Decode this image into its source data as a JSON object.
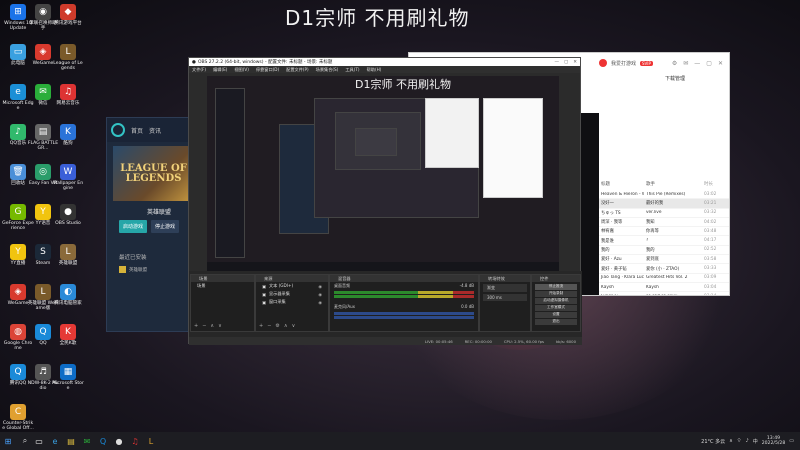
{
  "wallpaper": {
    "title": "D1宗师 不用刷礼物"
  },
  "desktop_icons": [
    {
      "label": "Windows 10 Update",
      "color": "#1a73e8",
      "glyph": "⊞"
    },
    {
      "label": "掌联召唤师助手",
      "color": "#444",
      "glyph": "◉"
    },
    {
      "label": "腾讯游戏平台",
      "color": "#cf3b2b",
      "glyph": "◆"
    },
    {
      "label": "此电脑",
      "color": "#3aa0e0",
      "glyph": "▭"
    },
    {
      "label": "WeGame",
      "color": "#d83a2e",
      "glyph": "◈"
    },
    {
      "label": "League of Legends",
      "color": "#7a5a2a",
      "glyph": "L"
    },
    {
      "label": "Microsoft Edge",
      "color": "#1b8fd6",
      "glyph": "e"
    },
    {
      "label": "微信",
      "color": "#2aae3a",
      "glyph": "✉"
    },
    {
      "label": "网易云音乐",
      "color": "#d33",
      "glyph": "♫"
    },
    {
      "label": "QQ音乐",
      "color": "#31b96c",
      "glyph": "♪"
    },
    {
      "label": "FLAG BATTLEGR...",
      "color": "#666",
      "glyph": "▤"
    },
    {
      "label": "酷狗",
      "color": "#2a73d8",
      "glyph": "K"
    },
    {
      "label": "回收站",
      "color": "#4a8fd8",
      "glyph": "🗑"
    },
    {
      "label": "Easy Fan VR",
      "color": "#2a9d6a",
      "glyph": "◎"
    },
    {
      "label": "Wallpaper Engine",
      "color": "#3a5fd8",
      "glyph": "W"
    },
    {
      "label": "GeForce Experience",
      "color": "#76b900",
      "glyph": "G"
    },
    {
      "label": "YY语音",
      "color": "#f1c40f",
      "glyph": "Y"
    },
    {
      "label": "OBS Studio",
      "color": "#333",
      "glyph": "●"
    },
    {
      "label": "YY直播",
      "color": "#f1c40f",
      "glyph": "Y"
    },
    {
      "label": "Steam",
      "color": "#1b2838",
      "glyph": "S"
    },
    {
      "label": "英雄联盟",
      "color": "#8a6a3a",
      "glyph": "L"
    },
    {
      "label": "WeGame",
      "color": "#d83a2e",
      "glyph": "◈"
    },
    {
      "label": "英雄联盟 WeGame版",
      "color": "#7a5a2a",
      "glyph": "L"
    },
    {
      "label": "腾讯电脑管家",
      "color": "#2a8ad8",
      "glyph": "◐"
    },
    {
      "label": "Google Chrome",
      "color": "#db4437",
      "glyph": "◍"
    },
    {
      "label": "QQ",
      "color": "#1a8ad8",
      "glyph": "Q"
    },
    {
      "label": "全民K歌",
      "color": "#e53935",
      "glyph": "K"
    },
    {
      "label": "腾讯QQ",
      "color": "#1a8ad8",
      "glyph": "Q"
    },
    {
      "label": "NDW-8K-2 Audio",
      "color": "#555",
      "glyph": "♬"
    },
    {
      "label": "Microsoft Store",
      "color": "#0d6cc6",
      "glyph": "▦"
    },
    {
      "label": "Counter-Strike Global Off...",
      "color": "#e0a030",
      "glyph": "C"
    }
  ],
  "launcher": {
    "tab1": "首页",
    "tab2": "资讯",
    "cover_text": "LEAGUE OF LEGENDS",
    "game_name": "英雄联盟",
    "start_label": "启动游戏",
    "alt_label": "停止游戏",
    "recent_label": "最近已安装",
    "recent_game": "英雄联盟"
  },
  "music": {
    "user": "我爱打游戏",
    "vip": "SVIP",
    "download": "下载管理",
    "cols": [
      "标题",
      "歌手",
      "时长"
    ],
    "tracks": [
      {
        "title": "Heaven & Hieron - Wo...",
        "artist": "This Pie (Remixes)",
        "time": "03:02"
      },
      {
        "title": "没好一",
        "artist": "最好的我",
        "time": "03:21"
      },
      {
        "title": "ちゅっ TS",
        "artist": "ver.live",
        "time": "03:32"
      },
      {
        "title": "周深 · 我等",
        "artist": "我知",
        "time": "04:02"
      },
      {
        "title": "林宥嘉",
        "artist": "你再等",
        "time": "03:48"
      },
      {
        "title": "我是谁",
        "artist": "?",
        "time": "04:17"
      },
      {
        "title": "我的",
        "artist": "我的",
        "time": "02:52"
      },
      {
        "title": "爱好 · Azu",
        "artist": "爱到底",
        "time": "03:58"
      },
      {
        "title": "爱好 · 黄子韬",
        "artist": "爱你 (小 · ZTAO)",
        "time": "03:33"
      },
      {
        "title": "Jiao Tang · Klara Luck",
        "artist": "Greatest Hits Vol. 2",
        "time": "03:09"
      },
      {
        "title": "Kaysh",
        "artist": "Kaysh",
        "time": "03:04"
      },
      {
        "title": "Lyrics Li",
        "artist": "so sad so sexy",
        "time": "03:14"
      },
      {
        "title": "Rujicho",
        "artist": "Dreams for Two",
        "time": "03:40"
      },
      {
        "title": "Matilder Wolf",
        "artist": "Animated in The Ocean",
        "time": "02:57"
      },
      {
        "title": "Kaysh",
        "artist": "Kaysh",
        "time": "03:48"
      }
    ]
  },
  "obs": {
    "title": "OBS 27.2.2 (64-bit, windows) - 配置文件: 未标题 - 场景: 未标题",
    "menu": [
      "文件(F)",
      "编辑(E)",
      "视图(V)",
      "停靠窗口(D)",
      "配置文件(P)",
      "场景集合(S)",
      "工具(T)",
      "帮助(H)"
    ],
    "preview_title": "D1宗师 不用刷礼物",
    "panels": {
      "scenes": "场景",
      "sources": "来源",
      "mixer": "混音器",
      "transitions": "转场特效",
      "controls": "控件"
    },
    "scene_item": "场景",
    "source_items": [
      "文本 (GDI+)",
      "显示器采集",
      "窗口采集"
    ],
    "mixer_channels": [
      "桌面音频",
      "麦克风/Aux"
    ],
    "mixer_db": [
      "-4.8 dB",
      "0.0 dB"
    ],
    "transition_mode": "渐变",
    "transition_duration": "300 ms",
    "controls": [
      "停止推流",
      "开始录制",
      "启动虚拟摄像机",
      "工作室模式",
      "设置",
      "退出"
    ],
    "status": [
      "LIVE: 00:05:46",
      "REC: 00:00:00",
      "CPU: 2.5%, 60.00 fps",
      "kb/s: 6000"
    ]
  },
  "taskbar": {
    "weather": "21°C 多云",
    "time": "13:49",
    "date": "2022/5/28"
  }
}
